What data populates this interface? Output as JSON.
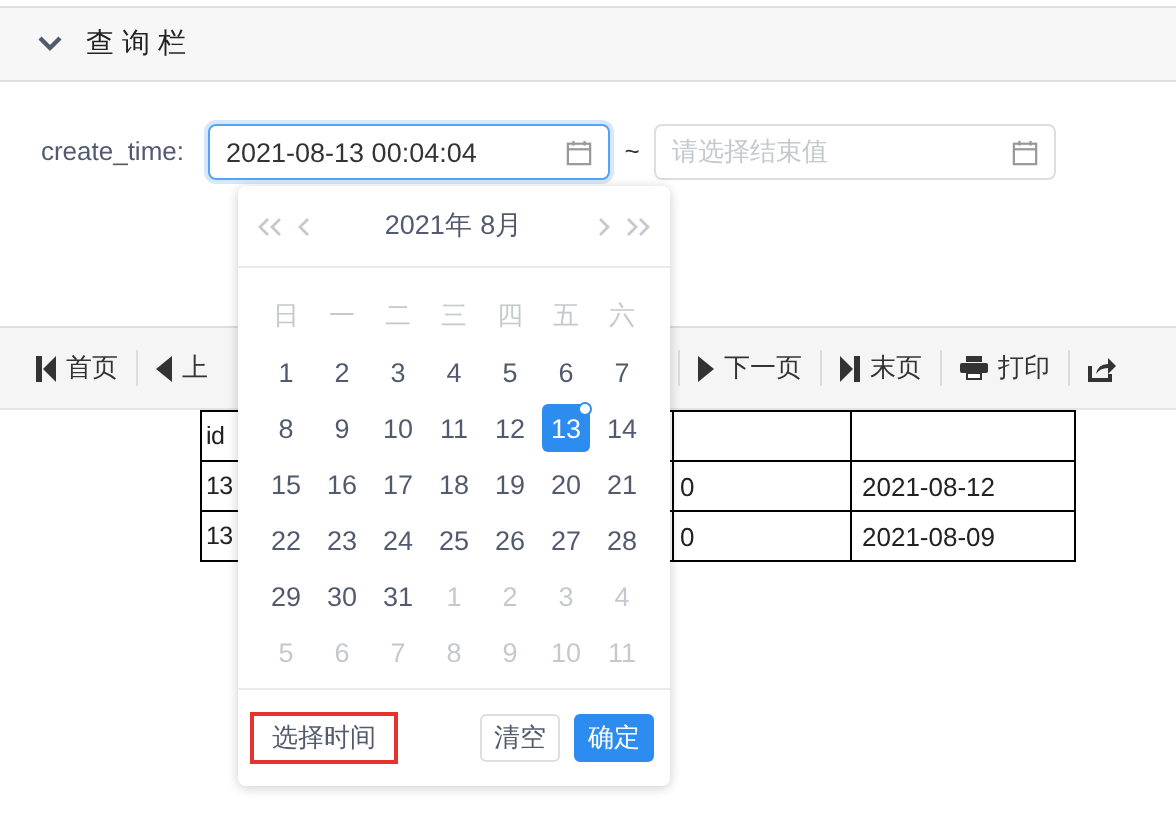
{
  "panel": {
    "title": "查询栏",
    "expanded": true
  },
  "filter": {
    "label": "create_time:",
    "start": {
      "value": "2021-08-13 00:04:04",
      "focused": true
    },
    "separator": "~",
    "end": {
      "placeholder": "请选择结束值"
    }
  },
  "toolbar": [
    {
      "label": "首页",
      "kind": "first"
    },
    {
      "label": "上",
      "kind": "prev"
    },
    {
      "label": "下一页",
      "kind": "next"
    },
    {
      "label": "末页",
      "kind": "last"
    },
    {
      "label": "打印",
      "kind": "print"
    },
    {
      "kind": "export"
    }
  ],
  "table": {
    "header": {
      "column_1": "id"
    },
    "rows": [
      {
        "column_1": "13",
        "column_2": "0",
        "column_3": "2021-08-12"
      },
      {
        "column_1": "13",
        "column_2": "0",
        "column_3": "2021-08-09"
      }
    ]
  },
  "datepicker": {
    "year_month": "2021年 8月",
    "weekdays": [
      "日",
      "一",
      "二",
      "三",
      "四",
      "五",
      "六"
    ],
    "weeks": [
      [
        {
          "day": "1",
          "in_month": true,
          "selected": false,
          "today": false
        },
        {
          "day": "2",
          "in_month": true,
          "selected": false,
          "today": false
        },
        {
          "day": "3",
          "in_month": true,
          "selected": false,
          "today": false
        },
        {
          "day": "4",
          "in_month": true,
          "selected": false,
          "today": false
        },
        {
          "day": "5",
          "in_month": true,
          "selected": false,
          "today": false
        },
        {
          "day": "6",
          "in_month": true,
          "selected": false,
          "today": false
        },
        {
          "day": "7",
          "in_month": true,
          "selected": false,
          "today": false
        }
      ],
      [
        {
          "day": "8",
          "in_month": true,
          "selected": false,
          "today": false
        },
        {
          "day": "9",
          "in_month": true,
          "selected": false,
          "today": false
        },
        {
          "day": "10",
          "in_month": true,
          "selected": false,
          "today": false
        },
        {
          "day": "11",
          "in_month": true,
          "selected": false,
          "today": false
        },
        {
          "day": "12",
          "in_month": true,
          "selected": false,
          "today": false
        },
        {
          "day": "13",
          "in_month": true,
          "selected": true,
          "today": true
        },
        {
          "day": "14",
          "in_month": true,
          "selected": false,
          "today": false
        }
      ],
      [
        {
          "day": "15",
          "in_month": true,
          "selected": false,
          "today": false
        },
        {
          "day": "16",
          "in_month": true,
          "selected": false,
          "today": false
        },
        {
          "day": "17",
          "in_month": true,
          "selected": false,
          "today": false
        },
        {
          "day": "18",
          "in_month": true,
          "selected": false,
          "today": false
        },
        {
          "day": "19",
          "in_month": true,
          "selected": false,
          "today": false
        },
        {
          "day": "20",
          "in_month": true,
          "selected": false,
          "today": false
        },
        {
          "day": "21",
          "in_month": true,
          "selected": false,
          "today": false
        }
      ],
      [
        {
          "day": "22",
          "in_month": true,
          "selected": false,
          "today": false
        },
        {
          "day": "23",
          "in_month": true,
          "selected": false,
          "today": false
        },
        {
          "day": "24",
          "in_month": true,
          "selected": false,
          "today": false
        },
        {
          "day": "25",
          "in_month": true,
          "selected": false,
          "today": false
        },
        {
          "day": "26",
          "in_month": true,
          "selected": false,
          "today": false
        },
        {
          "day": "27",
          "in_month": true,
          "selected": false,
          "today": false
        },
        {
          "day": "28",
          "in_month": true,
          "selected": false,
          "today": false
        }
      ],
      [
        {
          "day": "29",
          "in_month": true,
          "selected": false,
          "today": false
        },
        {
          "day": "30",
          "in_month": true,
          "selected": false,
          "today": false
        },
        {
          "day": "31",
          "in_month": true,
          "selected": false,
          "today": false
        },
        {
          "day": "1",
          "in_month": false,
          "selected": false,
          "today": false
        },
        {
          "day": "2",
          "in_month": false,
          "selected": false,
          "today": false
        },
        {
          "day": "3",
          "in_month": false,
          "selected": false,
          "today": false
        },
        {
          "day": "4",
          "in_month": false,
          "selected": false,
          "today": false
        }
      ],
      [
        {
          "day": "5",
          "in_month": false,
          "selected": false,
          "today": false
        },
        {
          "day": "6",
          "in_month": false,
          "selected": false,
          "today": false
        },
        {
          "day": "7",
          "in_month": false,
          "selected": false,
          "today": false
        },
        {
          "day": "8",
          "in_month": false,
          "selected": false,
          "today": false
        },
        {
          "day": "9",
          "in_month": false,
          "selected": false,
          "today": false
        },
        {
          "day": "10",
          "in_month": false,
          "selected": false,
          "today": false
        },
        {
          "day": "11",
          "in_month": false,
          "selected": false,
          "today": false
        }
      ]
    ],
    "time_button": {
      "label": "选择时间",
      "highlighted": true
    },
    "buttons": [
      {
        "label": "清空",
        "kind": "default"
      },
      {
        "label": "确定",
        "kind": "primary"
      }
    ]
  }
}
